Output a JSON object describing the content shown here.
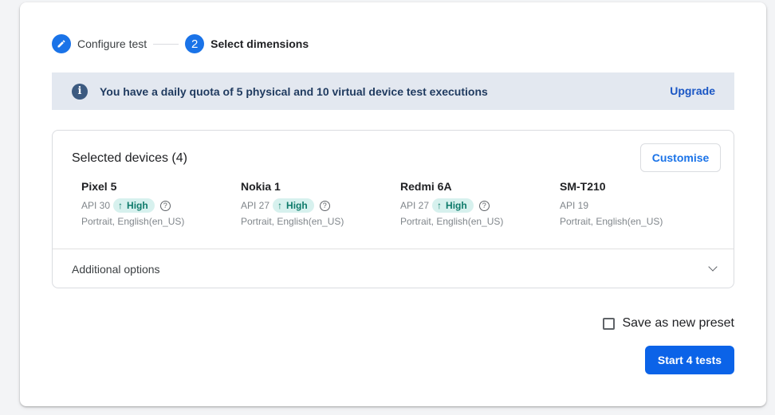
{
  "stepper": {
    "steps": [
      {
        "label": "Configure test",
        "icon": "pencil-icon",
        "state": "completed"
      },
      {
        "label": "Select dimensions",
        "number": "2",
        "state": "active"
      }
    ]
  },
  "banner": {
    "icon": "info-icon",
    "text": "You have a daily quota of 5 physical and 10 virtual device test executions",
    "action_label": "Upgrade"
  },
  "devices": {
    "title": "Selected devices (4)",
    "customise_label": "Customise",
    "items": [
      {
        "name": "Pixel 5",
        "api": "API 30",
        "badge": "High",
        "config": "Portrait, English(en_US)"
      },
      {
        "name": "Nokia 1",
        "api": "API 27",
        "badge": "High",
        "config": "Portrait, English(en_US)"
      },
      {
        "name": "Redmi 6A",
        "api": "API 27",
        "badge": "High",
        "config": "Portrait, English(en_US)"
      },
      {
        "name": "SM-T210",
        "api": "API 19",
        "badge": null,
        "config": "Portrait, English(en_US)"
      }
    ],
    "additional_options_label": "Additional options"
  },
  "footer": {
    "preset_label": "Save as new preset",
    "preset_checked": false,
    "start_label": "Start 4 tests"
  },
  "colors": {
    "accent": "#1a73e8",
    "badge_bg": "#d7f1ee",
    "badge_text": "#0d7a6a",
    "banner_bg": "#e3e8f0"
  }
}
